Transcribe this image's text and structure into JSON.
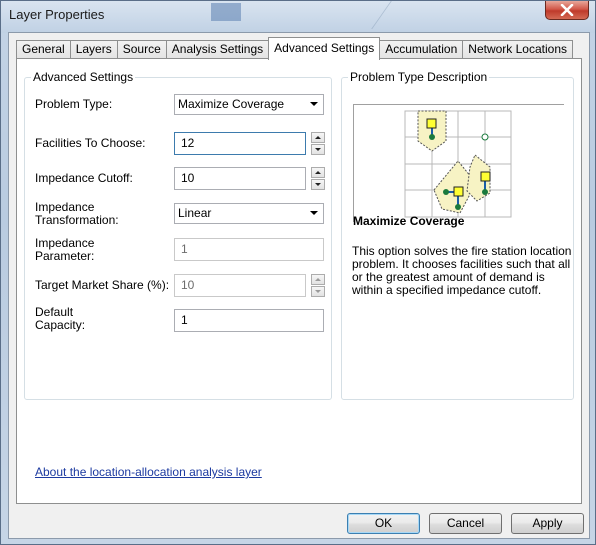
{
  "window": {
    "title": "Layer Properties"
  },
  "tabs": [
    {
      "label": "General"
    },
    {
      "label": "Layers"
    },
    {
      "label": "Source"
    },
    {
      "label": "Analysis Settings"
    },
    {
      "label": "Advanced Settings",
      "active": true
    },
    {
      "label": "Accumulation"
    },
    {
      "label": "Network Locations"
    }
  ],
  "advanced": {
    "group_title": "Advanced Settings",
    "problem_type": {
      "label": "Problem Type:",
      "value": "Maximize Coverage"
    },
    "facilities": {
      "label": "Facilities To Choose:",
      "value": "12"
    },
    "impedance_cutoff": {
      "label": "Impedance Cutoff:",
      "value": "10"
    },
    "impedance_transformation": {
      "label": "Impedance Transformation:",
      "value": "Linear"
    },
    "impedance_parameter": {
      "label": "Impedance Parameter:",
      "value": "1"
    },
    "target_market_share": {
      "label": "Target Market Share (%):",
      "value": "10"
    },
    "default_capacity": {
      "label": "Default Capacity:",
      "value": "1"
    }
  },
  "description": {
    "group_title": "Problem Type Description",
    "heading": "Maximize Coverage",
    "text": "This option solves the fire station location problem. It chooses facilities such that all or the greatest amount of demand is within a specified impedance cutoff."
  },
  "help_link": "About the location-allocation analysis layer",
  "buttons": {
    "ok": "OK",
    "cancel": "Cancel",
    "apply": "Apply"
  },
  "colors": {
    "accent": "#3c7fb1",
    "link": "#1c3aa0",
    "facility_fill": "#ffff33",
    "demand_point": "#1a7a3c",
    "coverage_area": "#f7f3c4"
  }
}
